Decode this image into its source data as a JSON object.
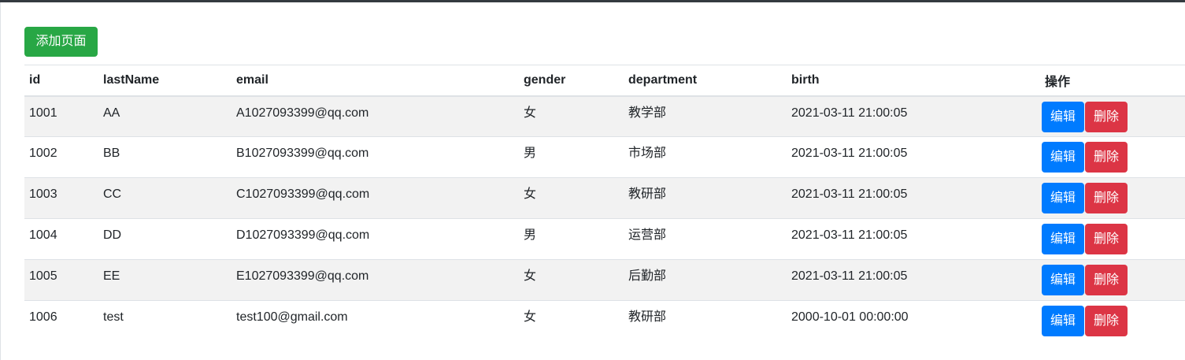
{
  "toolbar": {
    "add_label": "添加页面"
  },
  "table": {
    "headers": {
      "id": "id",
      "lastName": "lastName",
      "email": "email",
      "gender": "gender",
      "department": "department",
      "birth": "birth",
      "actions": "操作"
    },
    "rows": [
      {
        "id": "1001",
        "lastName": "AA",
        "email": "A1027093399@qq.com",
        "gender": "女",
        "department": "教学部",
        "birth": "2021-03-11 21:00:05",
        "edit": "编辑",
        "delete": "删除"
      },
      {
        "id": "1002",
        "lastName": "BB",
        "email": "B1027093399@qq.com",
        "gender": "男",
        "department": "市场部",
        "birth": "2021-03-11 21:00:05",
        "edit": "编辑",
        "delete": "删除"
      },
      {
        "id": "1003",
        "lastName": "CC",
        "email": "C1027093399@qq.com",
        "gender": "女",
        "department": "教研部",
        "birth": "2021-03-11 21:00:05",
        "edit": "编辑",
        "delete": "删除"
      },
      {
        "id": "1004",
        "lastName": "DD",
        "email": "D1027093399@qq.com",
        "gender": "男",
        "department": "运营部",
        "birth": "2021-03-11 21:00:05",
        "edit": "编辑",
        "delete": "删除"
      },
      {
        "id": "1005",
        "lastName": "EE",
        "email": "E1027093399@qq.com",
        "gender": "女",
        "department": "后勤部",
        "birth": "2021-03-11 21:00:05",
        "edit": "编辑",
        "delete": "删除"
      },
      {
        "id": "1006",
        "lastName": "test",
        "email": "test100@gmail.com",
        "gender": "女",
        "department": "教研部",
        "birth": "2000-10-01 00:00:00",
        "edit": "编辑",
        "delete": "删除"
      }
    ]
  },
  "colors": {
    "add": "#28a745",
    "edit": "#007bff",
    "delete": "#dc3545",
    "stripe": "#f2f2f2",
    "topbar": "#343a40"
  }
}
